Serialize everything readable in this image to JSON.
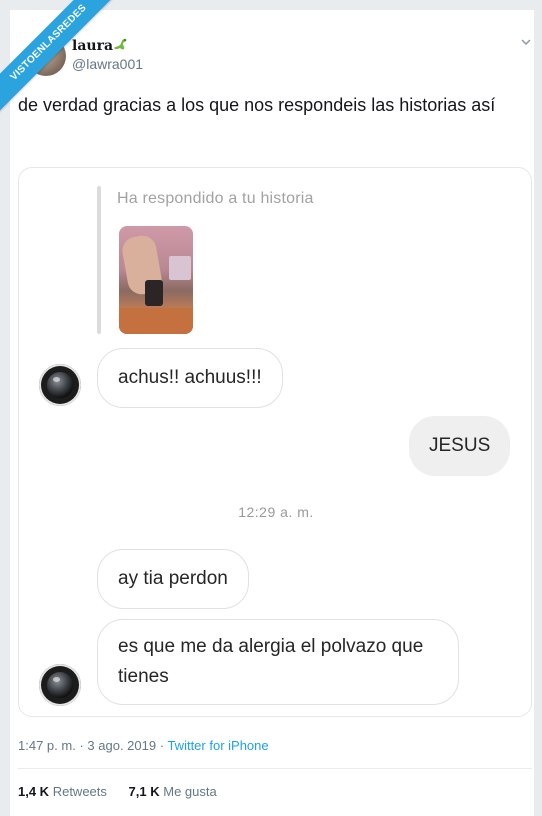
{
  "watermark": "VISTOENLASREDES",
  "author": {
    "name": "laura",
    "handle": "@lawra001"
  },
  "tweet": {
    "text": "de verdad gracias a los que nos respondeis las historias así"
  },
  "chat": {
    "reply_label": "Ha respondido a tu historia",
    "messages": [
      {
        "side": "in",
        "text": "achus!! achuus!!!"
      },
      {
        "side": "out",
        "text": "JESUS"
      },
      {
        "side": "in",
        "text": "ay tia perdon"
      },
      {
        "side": "in",
        "text": "es que me da alergia el polvazo que tienes"
      }
    ],
    "timestamp": "12:29 a. m."
  },
  "meta": {
    "time": "1:47 p. m.",
    "date": "3 ago. 2019",
    "separator": "·",
    "source": "Twitter for iPhone"
  },
  "stats": {
    "retweets_count": "1,4 K",
    "retweets_label": "Retweets",
    "likes_count": "7,1 K",
    "likes_label": "Me gusta"
  },
  "colors": {
    "ribbon": "#2aa3df",
    "link": "#1da1f2",
    "secondary_text": "#657786"
  }
}
